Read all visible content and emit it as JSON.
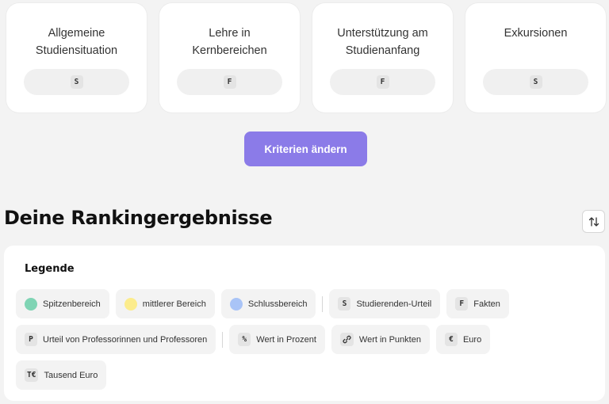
{
  "criteria_cards": [
    {
      "title_line1": "Allgemeine",
      "title_line2": "Studiensituation",
      "badge": "S"
    },
    {
      "title_line1": "Lehre in",
      "title_line2": "Kernbereichen",
      "badge": "F"
    },
    {
      "title_line1": "Unterstützung am",
      "title_line2": "Studienanfang",
      "badge": "F"
    },
    {
      "title_line1": "Exkursionen",
      "title_line2": "",
      "badge": "S"
    }
  ],
  "change_criteria_label": "Kriterien ändern",
  "results_heading": "Deine Rankingergebnisse",
  "sort_icon": "sort-arrows-icon",
  "legend": {
    "title": "Legende",
    "colors": {
      "top": "#7fd4b4",
      "middle": "#fcec8c",
      "bottom": "#a9c4f7",
      "accent": "#8b7be8"
    },
    "groups": [
      {
        "label": "Spitzenbereich"
      },
      {
        "label": "mittlerer Bereich"
      },
      {
        "label": "Schlussbereich"
      }
    ],
    "sources": [
      {
        "symbol": "S",
        "label": "Studierenden-Urteil"
      },
      {
        "symbol": "F",
        "label": "Fakten"
      },
      {
        "symbol": "P",
        "label": "Urteil von Professorinnen und Professoren"
      }
    ],
    "units": [
      {
        "symbol": "%",
        "label": "Wert in Prozent"
      },
      {
        "symbol": "link-icon",
        "label": "Wert in Punkten"
      },
      {
        "symbol": "€",
        "label": "Euro"
      },
      {
        "symbol": "T€",
        "label": "Tausend Euro"
      }
    ]
  }
}
